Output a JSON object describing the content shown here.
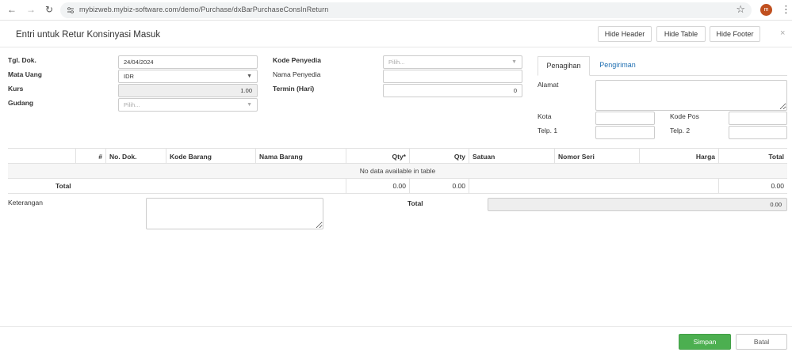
{
  "browser": {
    "url": "mybizweb.mybiz-software.com/demo/Purchase/dxBarPurchaseConsInReturn",
    "avatar_initial": "m"
  },
  "modal": {
    "title": "Entri untuk Retur Konsinyasi Masuk",
    "buttons": {
      "hide_header": "Hide Header",
      "hide_table": "Hide Table",
      "hide_footer": "Hide Footer"
    },
    "close": "×"
  },
  "form": {
    "tgl_dok_label": "Tgl. Dok.",
    "tgl_dok_value": "24/04/2024",
    "mata_uang_label": "Mata Uang",
    "mata_uang_value": "IDR",
    "kurs_label": "Kurs",
    "kurs_value": "1.00",
    "gudang_label": "Gudang",
    "gudang_placeholder": "Pilih...",
    "kode_penyedia_label": "Kode Penyedia",
    "kode_penyedia_placeholder": "Pilih...",
    "nama_penyedia_label": "Nama Penyedia",
    "nama_penyedia_value": "",
    "termin_label": "Termin (Hari)",
    "termin_value": "0"
  },
  "address": {
    "tabs": [
      "Penagihan",
      "Pengiriman"
    ],
    "alamat_label": "Alamat",
    "kota_label": "Kota",
    "kode_pos_label": "Kode Pos",
    "telp1_label": "Telp. 1",
    "telp2_label": "Telp. 2"
  },
  "table": {
    "headers": {
      "hash": "#",
      "no_dok": "No. Dok.",
      "kode_barang": "Kode Barang",
      "nama_barang": "Nama Barang",
      "qty_star": "Qty*",
      "qty": "Qty",
      "satuan": "Satuan",
      "nomor_seri": "Nomor Seri",
      "harga": "Harga",
      "total": "Total"
    },
    "empty_message": "No data available in table",
    "footer": {
      "label": "Total",
      "qty_star": "0.00",
      "qty": "0.00",
      "total": "0.00"
    }
  },
  "summary": {
    "keterangan_label": "Keterangan",
    "total_label": "Total",
    "total_value": "0.00"
  },
  "actions": {
    "save": "Simpan",
    "cancel": "Batal"
  },
  "colors": {
    "save_button": "#4caf50",
    "link": "#1f6fb2",
    "avatar": "#c0501f"
  }
}
